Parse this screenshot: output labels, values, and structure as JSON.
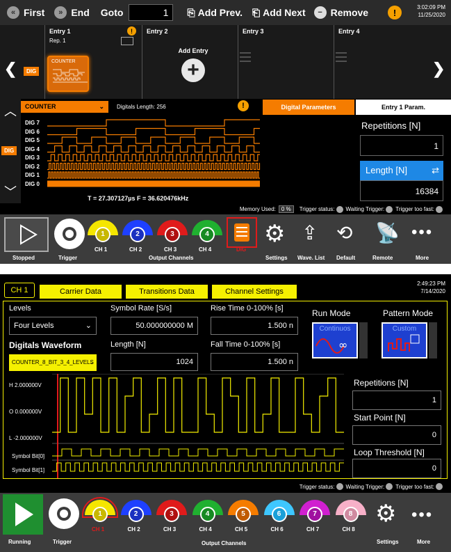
{
  "panel1": {
    "topbar": {
      "first": "First",
      "end": "End",
      "goto": "Goto",
      "goto_value": "1",
      "add_prev": "Add Prev.",
      "add_next": "Add Next",
      "remove": "Remove",
      "warn": "!",
      "time": "3:02:09 PM",
      "date": "11/25/2020"
    },
    "entries": {
      "entry1": "Entry 1",
      "rep": "Rep. 1",
      "entry2": "Entry 2",
      "entry3": "Entry 3",
      "entry4": "Entry 4",
      "counter_card": "COUNTER",
      "add_entry": "Add Entry",
      "dig_tag": "DIG"
    },
    "counter": {
      "select": "COUNTER",
      "digital_length": "Digitals Length: 256"
    },
    "tabs": {
      "digital_params": "Digital Parameters",
      "entry_params": "Entry 1 Param."
    },
    "dig_labels": [
      "DIG 7",
      "DIG 6",
      "DIG 5",
      "DIG 4",
      "DIG 3",
      "DIG 2",
      "DIG 1",
      "DIG 0"
    ],
    "side_tag": "DIG",
    "time_freq": "T =  27.307127µs  F =  36.620476kHz",
    "params": {
      "repetitions_label": "Repetitions [N]",
      "repetitions_value": "1",
      "length_label": "Length [N]",
      "length_value": "16384"
    },
    "memory": {
      "label": "Memory Used:",
      "value": "0 %",
      "trigger_status": "Trigger status:",
      "waiting": "Waiting Trigger:",
      "too_fast": "Trigger too fast:"
    },
    "toolbar": {
      "stopped": "Stopped",
      "trigger": "Trigger",
      "ch1": "CH 1",
      "ch2": "CH 2",
      "ch3": "CH 3",
      "ch4": "CH 4",
      "dig": "DIG",
      "output_channels": "Output Channels",
      "settings": "Settings",
      "wave_list": "Wave. List",
      "default": "Default",
      "remote": "Remote",
      "more": "More",
      "n1": "1",
      "n2": "2",
      "n3": "3",
      "n4": "4"
    }
  },
  "panel2": {
    "time": "2:49:23 PM",
    "date": "7/14/2020",
    "tabs": {
      "ch1": "CH 1",
      "carrier": "Carrier Data",
      "transitions": "Transitions Data",
      "channel": "Channel Settings"
    },
    "levels_label": "Levels",
    "levels_value": "Four Levels",
    "symbol_rate_label": "Symbol Rate [S/s]",
    "symbol_rate_value": "50.000000000 M",
    "rise_time_label": "Rise Time 0-100% [s]",
    "rise_time_value": "1.500 n",
    "run_mode_label": "Run Mode",
    "run_mode_value": "Continuos",
    "pattern_mode_label": "Pattern Mode",
    "pattern_mode_value": "Custom",
    "dig_wave_label": "Digitals Waveform",
    "dig_wave_value": "COUNTER_8_BIT_3_4_LEVELS",
    "length_label": "Length [N]",
    "length_value": "1024",
    "fall_time_label": "Fall Time 0-100% [s]",
    "fall_time_value": "1.500 n",
    "y_h": "H  2.000000V",
    "y_o": "O  0.000000V",
    "y_l": "L  -2.000000V",
    "sym0": "Symbol Bit[0]",
    "sym1": "Symbol Bit[1]",
    "repetitions_label": "Repetitions [N]",
    "repetitions_value": "1",
    "start_point_label": "Start Point [N]",
    "start_point_value": "0",
    "loop_threshold_label": "Loop Threshold [N]",
    "loop_threshold_value": "0",
    "trigger_status": "Trigger status:",
    "waiting": "Waiting Trigger:",
    "too_fast": "Trigger too fast:",
    "toolbar": {
      "running": "Running",
      "trigger": "Trigger",
      "output_channels": "Output Channels",
      "settings": "Settings",
      "more": "More",
      "channels": [
        "CH 1",
        "CH 2",
        "CH 3",
        "CH 4",
        "CH 5",
        "CH 6",
        "CH 7",
        "CH 8"
      ],
      "numbers": [
        "1",
        "2",
        "3",
        "4",
        "5",
        "6",
        "7",
        "8"
      ]
    }
  }
}
